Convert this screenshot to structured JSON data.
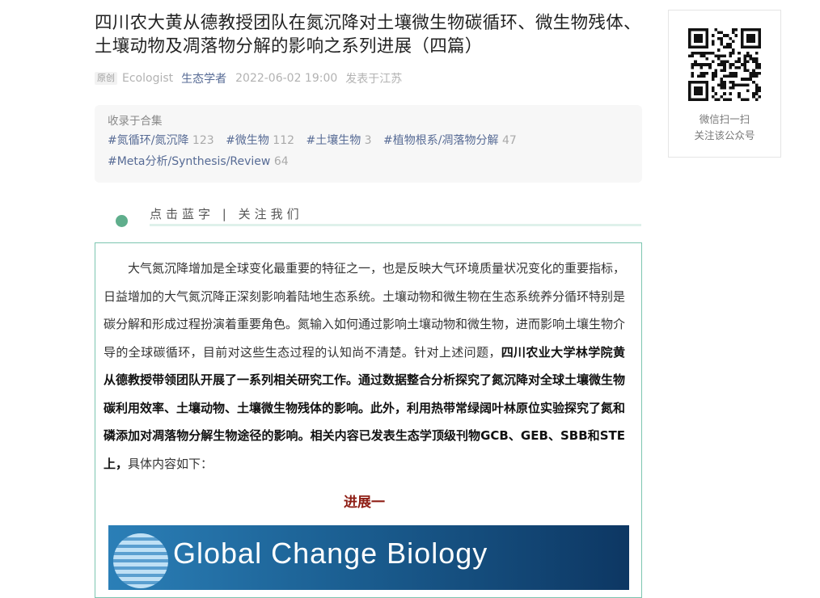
{
  "article": {
    "title": "四川农大黄从德教授团队在氮沉降对土壤微生物碳循环、微生物残体、土壤动物及凋落物分解的影响之系列进展（四篇）",
    "badge": "原创",
    "author": "Ecologist",
    "account": "生态学者",
    "date": "2022-06-02 19:00",
    "location": "发表于江苏"
  },
  "collection": {
    "label": "收录于合集",
    "tags": [
      {
        "name": "#氮循环/氮沉降",
        "count": "123"
      },
      {
        "name": "#微生物",
        "count": "112"
      },
      {
        "name": "#土壤生物",
        "count": "3"
      },
      {
        "name": "#植物根系/凋落物分解",
        "count": "47"
      },
      {
        "name": "#Meta分析/Synthesis/Review",
        "count": "64"
      }
    ]
  },
  "follow": {
    "text": "点击蓝字 | 关注我们"
  },
  "content": {
    "para_normal": "大气氮沉降增加是全球变化最重要的特征之一，也是反映大气环境质量状况变化的重要指标，日益增加的大气氮沉降正深刻影响着陆地生态系统。土壤动物和微生物在生态系统养分循环特别是碳分解和形成过程扮演着重要角色。氮输入如何通过影响土壤动物和微生物，进而影响土壤生物介导的全球碳循环，目前对这些生态过程的认知尚不清楚。针对上述问题，",
    "para_bold": "四川农业大学林学院黄从德教授带领团队开展了一系列相关研究工作。通过数据整合分析探究了氮沉降对全球土壤微生物碳利用效率、土壤动物、土壤微生物残体的影响。此外，利用热带常绿阔叶林原位实验探究了氮和磷添加对凋落物分解生物途径的影响。相关内容已发表生态学顶级刊物GCB、GEB、SBB和STE上，",
    "para_tail": "具体内容如下：",
    "progress_title": "进展一",
    "banner_text": "Global Change Biology"
  },
  "qr": {
    "line1": "微信扫一扫",
    "line2": "关注该公众号"
  },
  "colors": {
    "link": "#576b95",
    "accent_green": "#5fae8c",
    "border_green": "#7cc5b0",
    "progress_red": "#8e1d14"
  }
}
